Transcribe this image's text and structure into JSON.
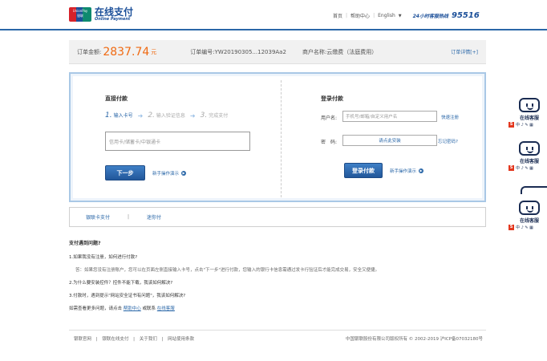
{
  "header": {
    "logo_badge_top": "UnionPay",
    "logo_badge_bottom": "银联",
    "logo_cn": "在线支付",
    "logo_en": "Online Payment",
    "nav": [
      "首页",
      "帮助中心",
      "English"
    ],
    "hotline_label": "24小时客服热线",
    "hotline_number": "95516"
  },
  "order": {
    "amount_label": "订单金额:",
    "amount": "2837.74",
    "amount_unit": "元",
    "order_no_label": "订单编号:",
    "order_no": "YW20190305...12039Aa2",
    "merchant_label": "商户名称:",
    "merchant": "云缴费（法庭费用）",
    "details_link": "订单详情[+]"
  },
  "direct_pay": {
    "title": "直接付款",
    "steps": [
      {
        "num": "1.",
        "label": "输入卡号"
      },
      {
        "num": "2.",
        "label": "输入验证信息"
      },
      {
        "num": "3.",
        "label": "完成支付"
      }
    ],
    "card_placeholder": "信用卡/储蓄卡/中银通卡",
    "next_button": "下一步",
    "guide_link": "新手操作演示"
  },
  "login_pay": {
    "title": "登录付款",
    "username_label": "用户名:",
    "username_placeholder": "手机号/邮箱/自定义用户名",
    "register_link": "快速注册",
    "password_label": "密　码:",
    "password_placeholder": "请点此安装",
    "forgot_link": "忘记密码?",
    "login_button": "登录付款",
    "guide_link": "新手操作演示"
  },
  "methods": [
    "银联卡支付",
    "|",
    "迷你付"
  ],
  "faq": {
    "title": "支付遇到问题?",
    "q1": "1.如果我没有注册，如何进行付款?",
    "a1": "答：如果您没有注册账户，您可以在页面左侧直接输入卡号，点击\"下一步\"进行付款，您输入的银行卡信息需通过发卡行验证后才能完成交易，安全又便捷。",
    "q2": "2.为什么要安装控件？控件不能下载，我该如何解决?",
    "q3": "3.付款时，遇到提示\"网站安全证书有问题\"，我该如何解决?",
    "more_prefix": "如需查看更多问题，请点击",
    "help_link": "帮助中心",
    "more_mid": "或联系",
    "service_link": "在线客服"
  },
  "footer": {
    "links": [
      "银联官网",
      "|",
      "银联在线支付",
      "|",
      "关于我们",
      "|",
      "网站使用条款"
    ],
    "copyright": "中国银联股份有限公司版权所有 © 2002-2019  沪ICP备07032180号"
  },
  "side_service": {
    "label": "在线客服",
    "icons": "中 ♪ ✎ ▦"
  }
}
